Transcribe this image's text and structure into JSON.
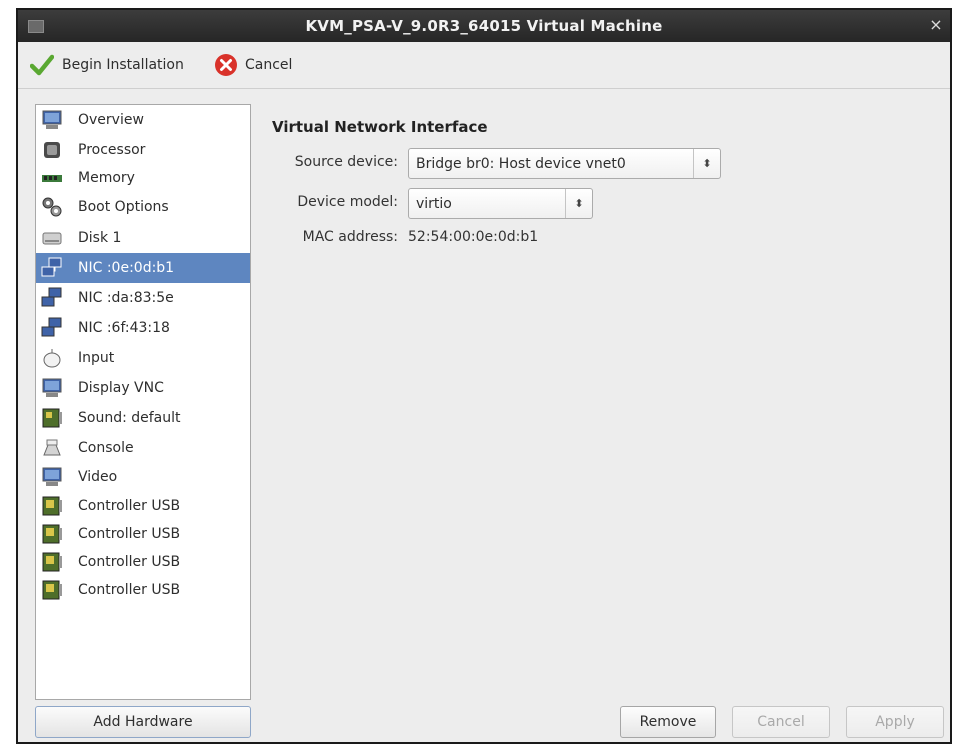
{
  "window": {
    "title": "KVM_PSA-V_9.0R3_64015 Virtual Machine",
    "close_glyph": "×"
  },
  "toolbar": {
    "begin_label": "Begin Installation",
    "cancel_label": "Cancel"
  },
  "sidebar": {
    "selected_index": 5,
    "items": [
      {
        "label": "Overview",
        "icon": "monitor-icon"
      },
      {
        "label": "Processor",
        "icon": "processor-icon"
      },
      {
        "label": "Memory",
        "icon": "memory-icon"
      },
      {
        "label": "Boot Options",
        "icon": "boot-options-icon"
      },
      {
        "label": "Disk 1",
        "icon": "disk-icon"
      },
      {
        "label": "NIC :0e:0d:b1",
        "icon": "nic-icon"
      },
      {
        "label": "NIC :da:83:5e",
        "icon": "nic-icon"
      },
      {
        "label": "NIC :6f:43:18",
        "icon": "nic-icon"
      },
      {
        "label": "Input",
        "icon": "mouse-icon"
      },
      {
        "label": "Display VNC",
        "icon": "display-icon"
      },
      {
        "label": "Sound: default",
        "icon": "sound-card-icon"
      },
      {
        "label": "Console",
        "icon": "console-icon"
      },
      {
        "label": "Video",
        "icon": "video-icon"
      },
      {
        "label": "Controller USB",
        "icon": "controller-icon"
      },
      {
        "label": "Controller USB",
        "icon": "controller-icon"
      },
      {
        "label": "Controller USB",
        "icon": "controller-icon"
      },
      {
        "label": "Controller USB",
        "icon": "controller-icon"
      }
    ],
    "add_hardware_label": "Add Hardware"
  },
  "details": {
    "section_title": "Virtual Network Interface",
    "source_device_label": "Source device:",
    "source_device_value": "Bridge br0: Host device vnet0",
    "device_model_label": "Device model:",
    "device_model_value": "virtio",
    "mac_label": "MAC address:",
    "mac_value": "52:54:00:0e:0d:b1",
    "combo_arrow": "⬍"
  },
  "buttons": {
    "remove": "Remove",
    "cancel": "Cancel",
    "apply": "Apply"
  }
}
